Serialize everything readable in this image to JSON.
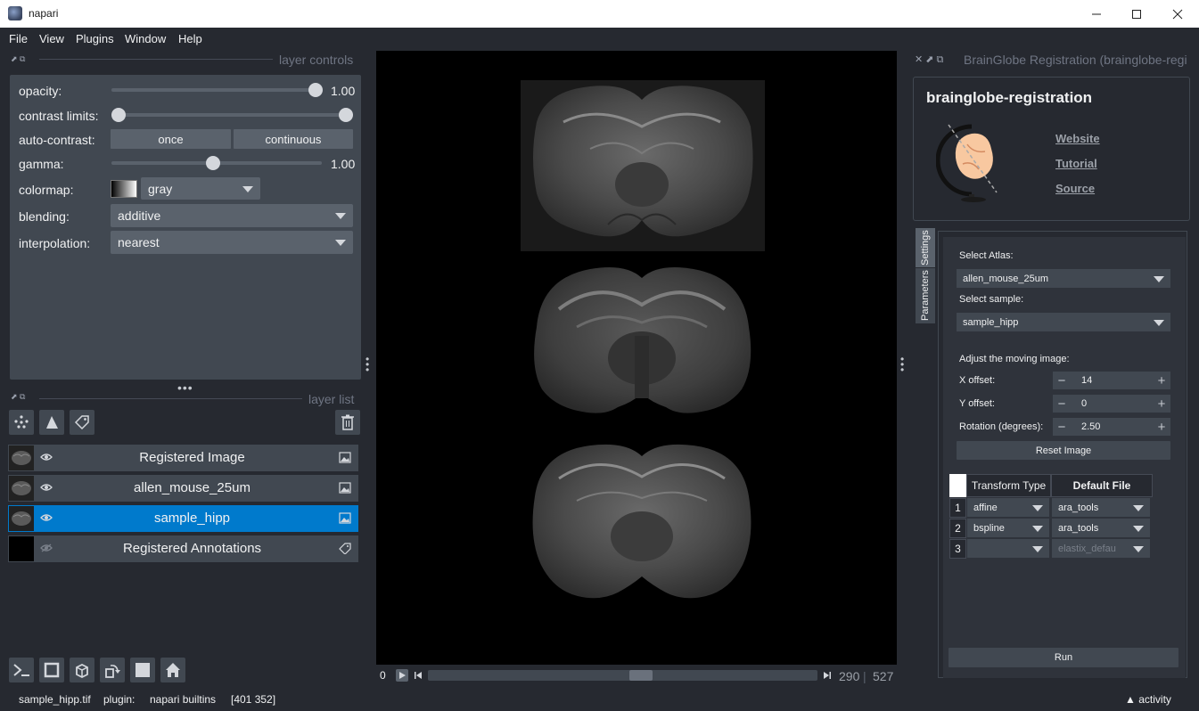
{
  "window": {
    "title": "napari",
    "controls": {
      "minimize": "—",
      "maximize": "☐",
      "close": "✕"
    }
  },
  "menu": [
    {
      "label": "File"
    },
    {
      "label": "View"
    },
    {
      "label": "Plugins"
    },
    {
      "label": "Window"
    },
    {
      "label": "Help"
    }
  ],
  "layer_controls": {
    "dock_title": "layer controls",
    "opacity": {
      "label": "opacity:",
      "value": "1.00",
      "fraction": 1.0
    },
    "contrast_limits": {
      "label": "contrast limits:",
      "low": 0.0,
      "high": 1.0
    },
    "auto_contrast": {
      "label": "auto-contrast:",
      "once": "once",
      "continuous": "continuous"
    },
    "gamma": {
      "label": "gamma:",
      "value": "1.00",
      "fraction": 0.45
    },
    "colormap": {
      "label": "colormap:",
      "value": "gray"
    },
    "blending": {
      "label": "blending:",
      "value": "additive"
    },
    "interpolation": {
      "label": "interpolation:",
      "value": "nearest"
    }
  },
  "layer_list": {
    "dock_title": "layer list",
    "layers": [
      {
        "name": "Registered Image",
        "type": "image",
        "visible": true,
        "selected": false
      },
      {
        "name": "allen_mouse_25um",
        "type": "image",
        "visible": true,
        "selected": false
      },
      {
        "name": "sample_hipp",
        "type": "image",
        "visible": true,
        "selected": true
      },
      {
        "name": "Registered Annotations",
        "type": "labels",
        "visible": false,
        "selected": false
      }
    ]
  },
  "dims": {
    "start": "0",
    "current": "290",
    "total": "527",
    "fraction": 0.55
  },
  "status": {
    "file": "sample_hipp.tif",
    "plugin_label": "plugin:",
    "plugin_name": "napari builtins",
    "coords": "[401 352]",
    "activity": "activity"
  },
  "right_dock": {
    "title": "BrainGlobe Registration (brainglobe-regi",
    "header": {
      "name": "brainglobe-registration",
      "links": [
        "Website",
        "Tutorial",
        "Source"
      ]
    },
    "tabs": [
      "Settings",
      "Parameters"
    ],
    "settings": {
      "atlas_label": "Select Atlas:",
      "atlas_value": "allen_mouse_25um",
      "sample_label": "Select sample:",
      "sample_value": "sample_hipp",
      "adjust_label": "Adjust the moving image:",
      "x_offset": {
        "label": "X offset:",
        "value": "14"
      },
      "y_offset": {
        "label": "Y offset:",
        "value": "0"
      },
      "rotation": {
        "label": "Rotation (degrees):",
        "value": "2.50"
      },
      "reset_button": "Reset Image",
      "table": {
        "headers": [
          "Transform Type",
          "Default File"
        ],
        "rows": [
          {
            "num": "1",
            "transform": "affine",
            "file": "ara_tools"
          },
          {
            "num": "2",
            "transform": "bspline",
            "file": "ara_tools"
          },
          {
            "num": "3",
            "transform": "",
            "file": "elastix_defau"
          }
        ]
      },
      "run_button": "Run"
    }
  },
  "colors": {
    "background": "#262930",
    "panel": "#414851",
    "selected": "#007acc",
    "accent_brain": "#f8c8a0"
  }
}
